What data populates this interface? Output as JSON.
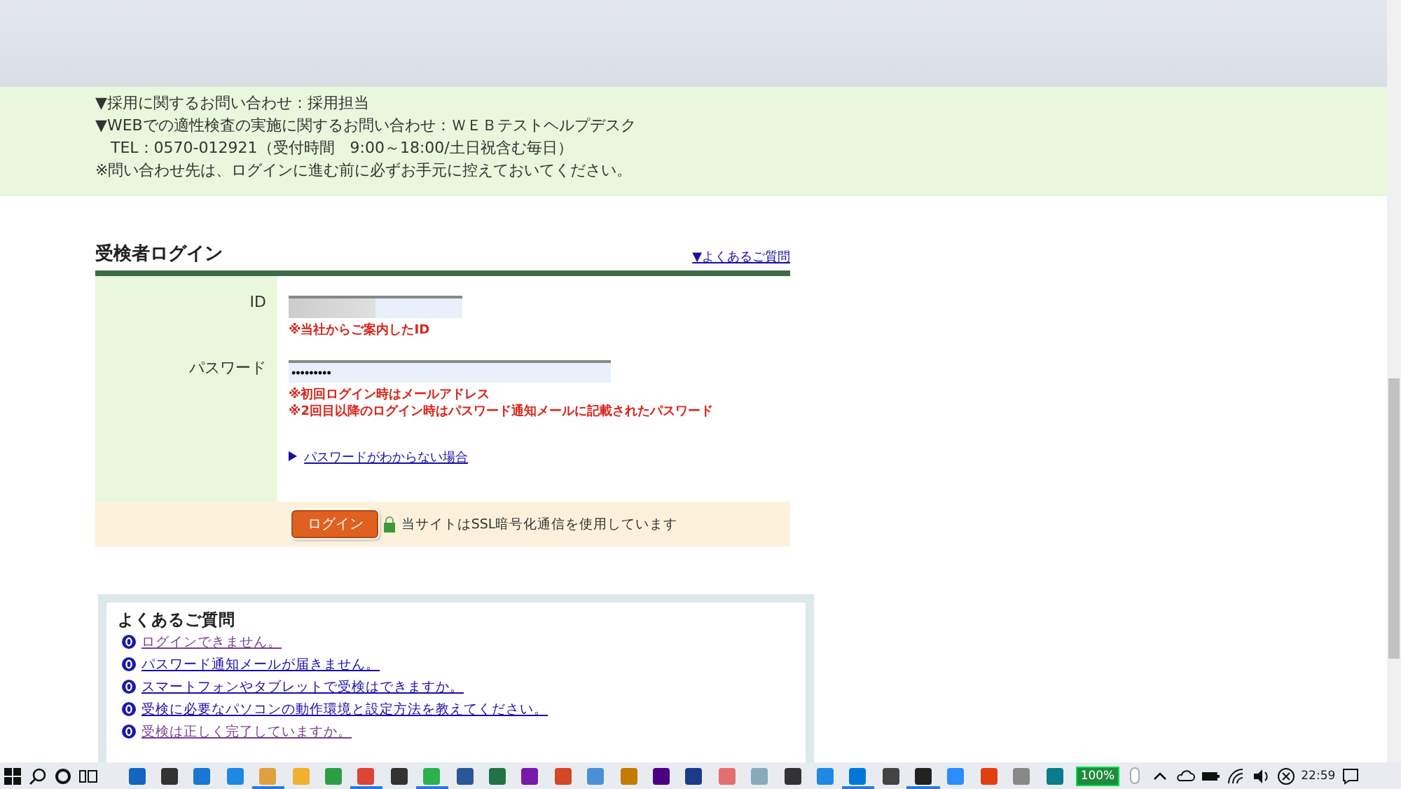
{
  "info": {
    "lines": [
      "▼採用に関するお問い合わせ：採用担当",
      "▼WEBでの適性検査の実施に関するお問い合わせ：ＷＥＢテストヘルプデスク",
      "　TEL：0570-012921（受付時間　9:00～18:00/土日祝含む毎日）",
      "※問い合わせ先は、ログインに進む前に必ずお手元に控えておいてください。"
    ]
  },
  "login": {
    "title": "受検者ログイン",
    "faq_link": "▼よくあるご質問",
    "fields": [
      {
        "label": "ID",
        "kind": "text",
        "notes": [
          "※当社からご案内したID"
        ]
      },
      {
        "label": "パスワード",
        "kind": "password",
        "value": "•••••••••",
        "notes": [
          "※初回ログイン時はメールアドレス",
          "※2回目以降のログイン時はパスワード通知メールに記載されたパスワード"
        ]
      }
    ],
    "forgot_link": "パスワードがわからない場合",
    "button": "ログイン",
    "ssl_note": "当サイトはSSL暗号化通信を使用しています"
  },
  "faq": {
    "title": "よくあるご質問",
    "items": [
      {
        "text": "ログインできません。",
        "visited": true
      },
      {
        "text": "パスワード通知メールが届きません。",
        "visited": false
      },
      {
        "text": "スマートフォンやタブレットで受検はできますか。",
        "visited": false
      },
      {
        "text": "受検に必要なパソコンの動作環境と設定方法を教えてください。",
        "visited": false
      },
      {
        "text": "受検は正しく完了していますか。",
        "visited": true
      }
    ]
  },
  "taskbar": {
    "apps": [
      {
        "running": false
      },
      {
        "running": false
      },
      {
        "running": false
      },
      {
        "running": false
      },
      {
        "running": true
      },
      {
        "running": false
      },
      {
        "running": false
      },
      {
        "running": true
      },
      {
        "running": false
      },
      {
        "running": true
      },
      {
        "running": false
      },
      {
        "running": false
      },
      {
        "running": false
      },
      {
        "running": false
      },
      {
        "running": false
      },
      {
        "running": false
      },
      {
        "running": false
      },
      {
        "running": false
      },
      {
        "running": false
      },
      {
        "running": false
      },
      {
        "running": false
      },
      {
        "running": false
      },
      {
        "running": true
      },
      {
        "running": false
      },
      {
        "running": true
      },
      {
        "running": false
      },
      {
        "running": false
      },
      {
        "running": false
      },
      {
        "running": false
      }
    ],
    "battery": "100%",
    "clock": "22:59"
  }
}
